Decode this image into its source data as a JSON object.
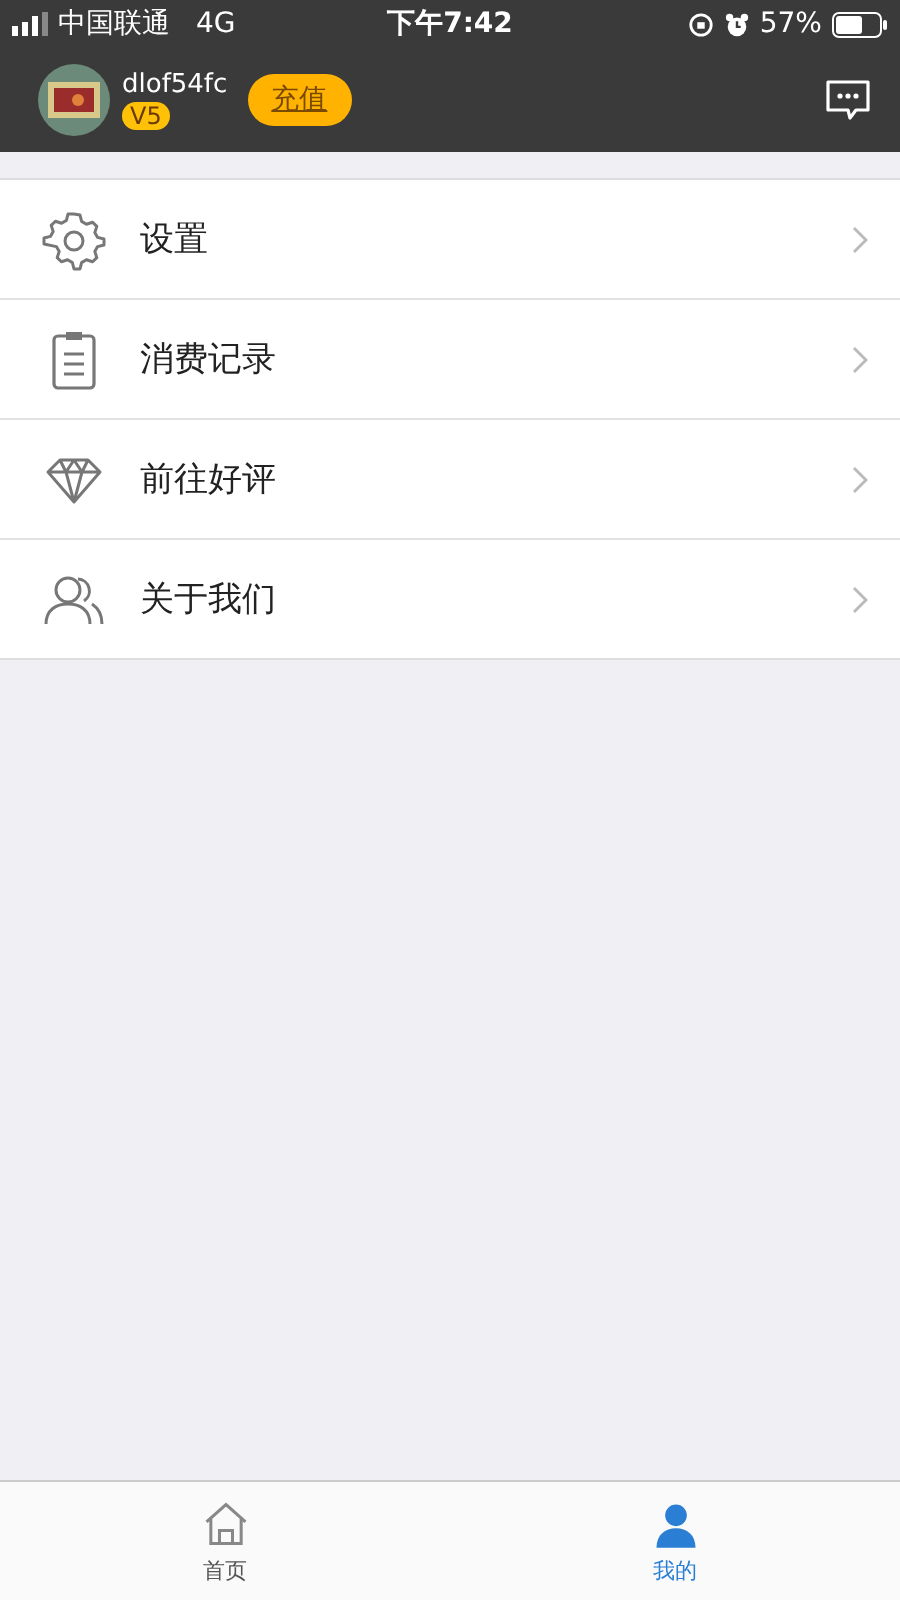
{
  "status_bar": {
    "carrier": "中国联通",
    "network": "4G",
    "time": "下午7:42",
    "battery": "57%"
  },
  "profile": {
    "username": "dlof54fc",
    "level_badge": "V5",
    "recharge_button": "充值"
  },
  "menu": [
    {
      "kind": "settings",
      "label": "设置"
    },
    {
      "kind": "records",
      "label": "消费记录"
    },
    {
      "kind": "rate",
      "label": "前往好评"
    },
    {
      "kind": "about",
      "label": "关于我们"
    }
  ],
  "tab_bar": [
    {
      "kind": "home",
      "label": "首页",
      "selected": false
    },
    {
      "kind": "me",
      "label": "我的",
      "selected": true
    }
  ]
}
